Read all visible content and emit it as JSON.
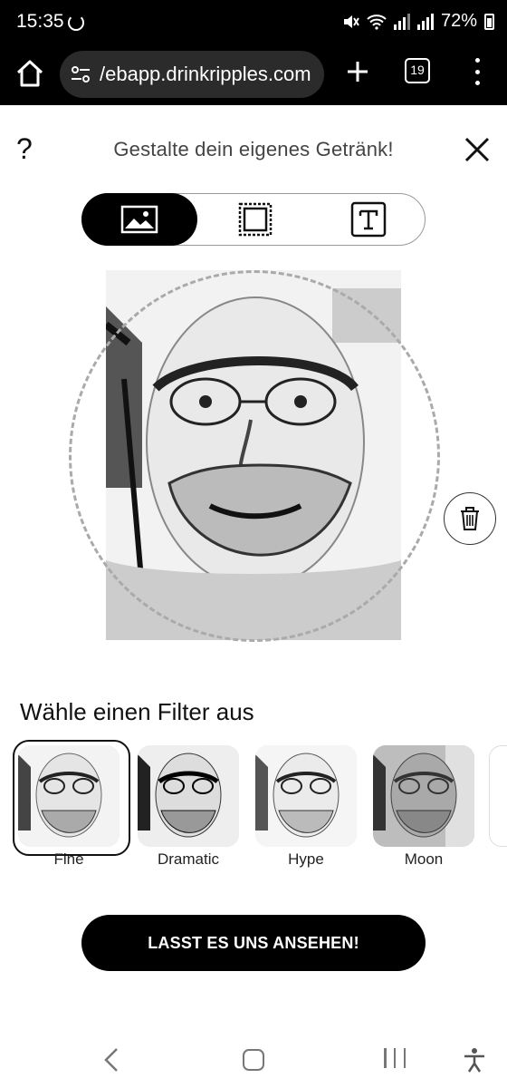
{
  "status": {
    "time": "15:35",
    "battery": "72%"
  },
  "browser": {
    "url": "/ebapp.drinkripples.com",
    "tab_count": "19"
  },
  "header": {
    "help_label": "?",
    "title": "Gestalte dein eigenes Getränk!"
  },
  "mode_tabs": [
    {
      "name": "image",
      "icon": "image-icon",
      "active": true
    },
    {
      "name": "frame",
      "icon": "frame-icon",
      "active": false
    },
    {
      "name": "text",
      "icon": "text-icon",
      "active": false
    }
  ],
  "filters": {
    "title": "Wähle einen Filter aus",
    "items": [
      {
        "label": "Fine",
        "selected": true
      },
      {
        "label": "Dramatic",
        "selected": false
      },
      {
        "label": "Hype",
        "selected": false
      },
      {
        "label": "Moon",
        "selected": false
      }
    ]
  },
  "cta": {
    "label": "LASST ES UNS ANSEHEN!"
  }
}
